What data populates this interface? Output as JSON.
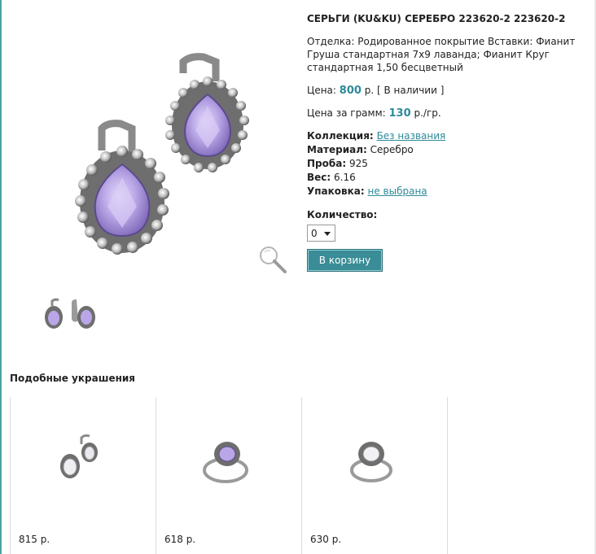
{
  "product": {
    "title": "СЕРЬГИ (KU&KU) СЕРЕБРО 223620-2 223620-2",
    "description": "Отделка: Родированное покрытие Вставки: Фианит Груша стандартная 7х9 лаванда; Фианит Круг стандартная 1,50 бесцветный",
    "price_label": "Цена:",
    "price_value": "800",
    "price_suffix": "р. [ В наличии ]",
    "gram_label": "Цена за грамм:",
    "gram_value": "130",
    "gram_suffix": "р./гр.",
    "attributes": {
      "collection_label": "Коллекция:",
      "collection_value": "Без названия",
      "material_label": "Материал:",
      "material_value": "Серебро",
      "assay_label": "Проба:",
      "assay_value": "925",
      "weight_label": "Вес:",
      "weight_value": "6.16",
      "package_label": "Упаковка:",
      "package_value": "не выбрана"
    },
    "quantity_label": "Количество:",
    "quantity_value": "0",
    "cart_button": "В корзину"
  },
  "similar": {
    "title": "Подобные украшения",
    "items": [
      {
        "price": "815 р."
      },
      {
        "price": "618 р."
      },
      {
        "price": "630 р."
      }
    ]
  },
  "colors": {
    "accent": "#2f8a9a",
    "button": "#3a8c96",
    "stone_lavender": "#b9a6e6",
    "silver": "#8a8a8a"
  },
  "icons": {
    "zoom": "magnifier-icon"
  }
}
